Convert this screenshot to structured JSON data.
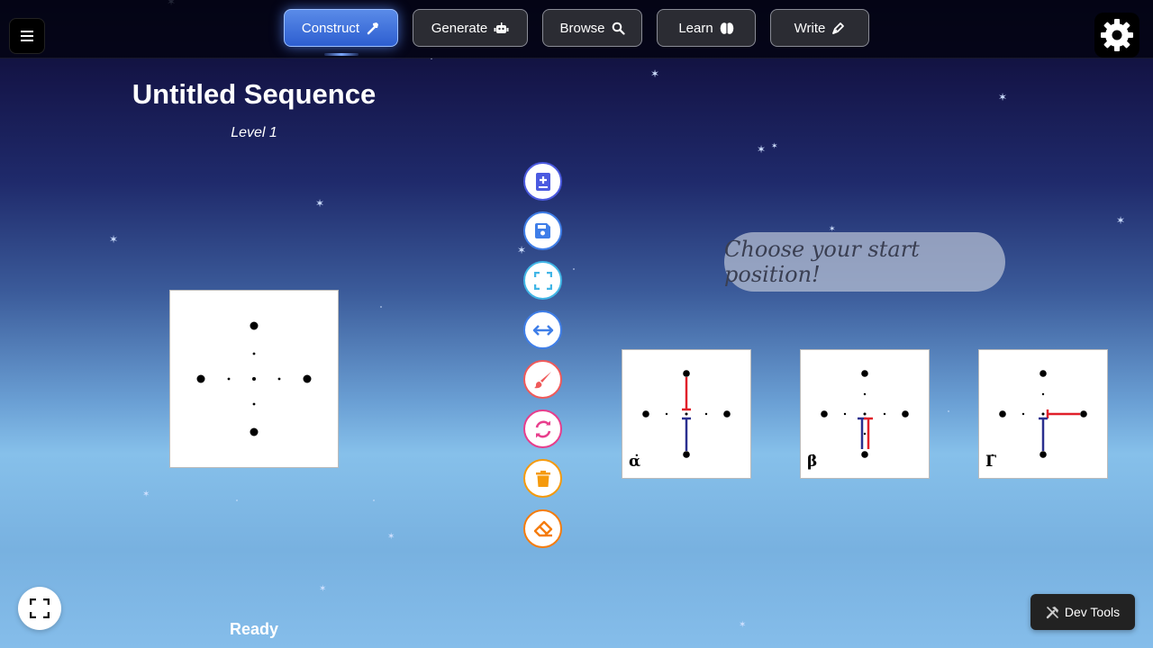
{
  "nav": {
    "items": [
      {
        "label": "Construct",
        "icon": "hammer-icon",
        "active": true
      },
      {
        "label": "Generate",
        "icon": "robot-icon",
        "active": false
      },
      {
        "label": "Browse",
        "icon": "search-icon",
        "active": false
      },
      {
        "label": "Learn",
        "icon": "brain-icon",
        "active": false
      },
      {
        "label": "Write",
        "icon": "pen-icon",
        "active": false
      }
    ]
  },
  "sequence": {
    "title": "Untitled Sequence",
    "level": "Level 1"
  },
  "tools": [
    {
      "name": "add-to-dictionary",
      "icon": "book-plus-icon",
      "color": "#4b5ae0"
    },
    {
      "name": "save",
      "icon": "save-icon",
      "color": "#3f7ee8"
    },
    {
      "name": "full-screen-view",
      "icon": "expand-icon",
      "color": "#41b6e6"
    },
    {
      "name": "mirror",
      "icon": "arrows-horizontal-icon",
      "color": "#3f7ee8"
    },
    {
      "name": "color-swap",
      "icon": "paintbrush-icon",
      "color": "#f05a5a"
    },
    {
      "name": "rotate",
      "icon": "sync-icon",
      "color": "#e83e8c"
    },
    {
      "name": "delete",
      "icon": "trash-icon",
      "color": "#f59a0c"
    },
    {
      "name": "clear",
      "icon": "eraser-icon",
      "color": "#f57c0c"
    }
  ],
  "prompt": "Choose your start position!",
  "start_options": [
    {
      "label": "α̇",
      "variant": "alpha"
    },
    {
      "label": "β̇",
      "variant": "beta"
    },
    {
      "label": "Γ̇",
      "variant": "gamma"
    }
  ],
  "status": "Ready",
  "devtools": {
    "label": "Dev Tools",
    "icon": "tools-icon"
  },
  "colors": {
    "accent": "#3b6fe0",
    "red_prop": "#e0202a",
    "blue_prop": "#2a2f8f"
  }
}
